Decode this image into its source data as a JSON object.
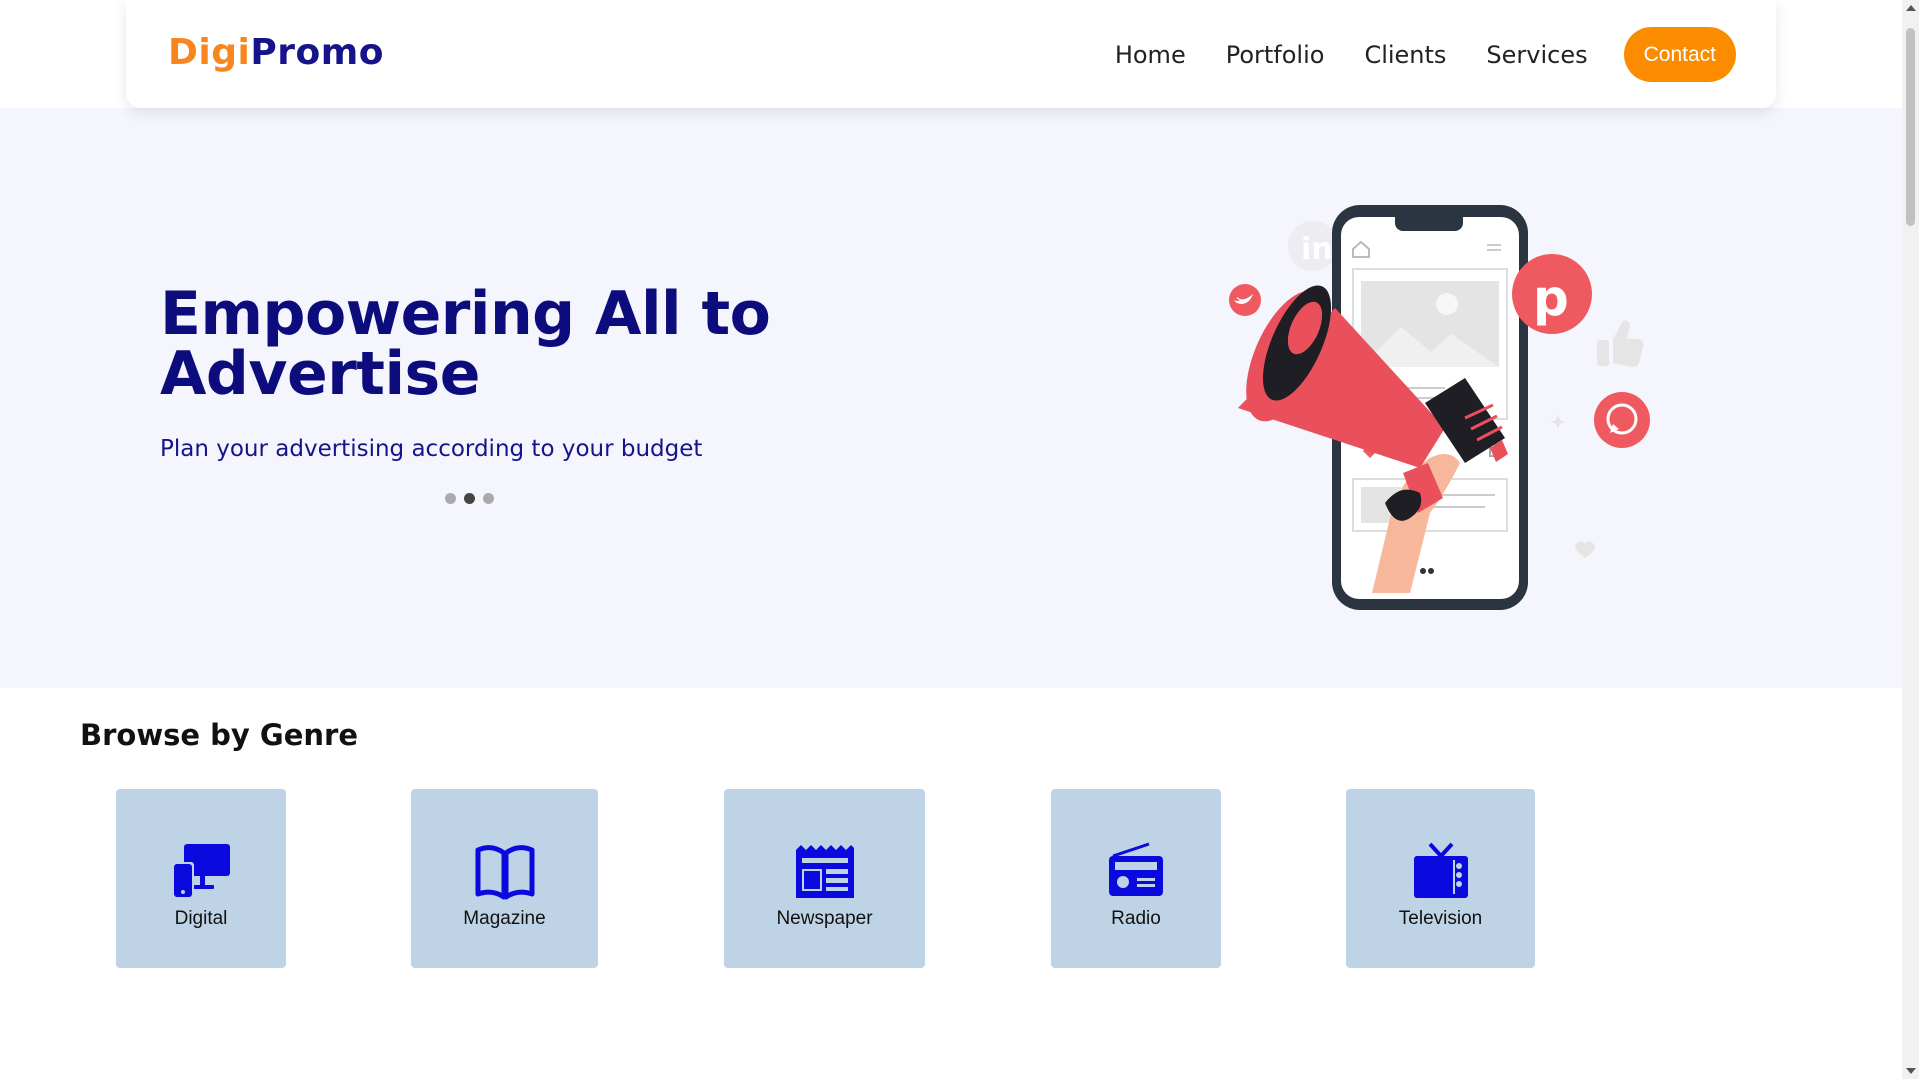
{
  "header": {
    "logo_part1": "Digi",
    "logo_part2": "Promo",
    "nav": [
      "Home",
      "Portfolio",
      "Clients",
      "Services"
    ],
    "contact_label": "Contact"
  },
  "hero": {
    "title": "Empowering All to Advertise",
    "subtitle": "Plan your advertising according to your budget",
    "carousel_active_index": 1,
    "carousel_count": 3
  },
  "browse": {
    "title": "Browse by Genre",
    "genres": [
      {
        "label": "Digital",
        "icon": "devices-icon"
      },
      {
        "label": "Magazine",
        "icon": "book-icon"
      },
      {
        "label": "Newspaper",
        "icon": "newspaper-icon"
      },
      {
        "label": "Radio",
        "icon": "radio-icon"
      },
      {
        "label": "Television",
        "icon": "tv-icon"
      }
    ]
  },
  "colors": {
    "brand_orange": "#f7861f",
    "brand_navy": "#16148a",
    "contact_button": "#fb8c00",
    "hero_bg": "#f4f5fd",
    "genre_card_bg": "#bfd3e6",
    "icon_blue": "#0a0adf",
    "megaphone_red": "#e9505c"
  }
}
